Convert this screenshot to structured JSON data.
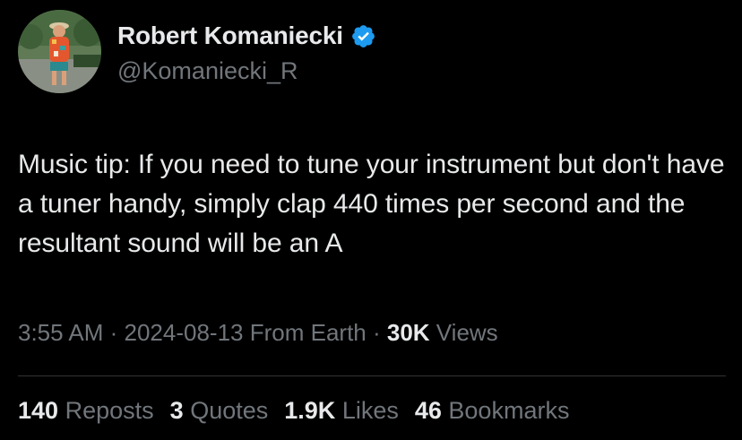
{
  "author": {
    "display_name": "Robert Komaniecki",
    "handle": "@Komaniecki_R",
    "verified_icon": "verified-badge-icon",
    "badge_color": "#1d9bf0"
  },
  "tweet": {
    "text": "Music tip: If you need to tune your instrument but don't have a tuner handy, simply clap 440 times per second and the resultant sound will be an A"
  },
  "meta": {
    "time": "3:55 AM",
    "sep1": " · ",
    "date": "2024-08-13",
    "location": " From Earth",
    "sep2": " · ",
    "views_count": "30K",
    "views_label": " Views"
  },
  "stats": {
    "reposts_count": "140",
    "reposts_label": "Reposts",
    "quotes_count": "3",
    "quotes_label": "Quotes",
    "likes_count": "1.9K",
    "likes_label": "Likes",
    "bookmarks_count": "46",
    "bookmarks_label": "Bookmarks"
  }
}
